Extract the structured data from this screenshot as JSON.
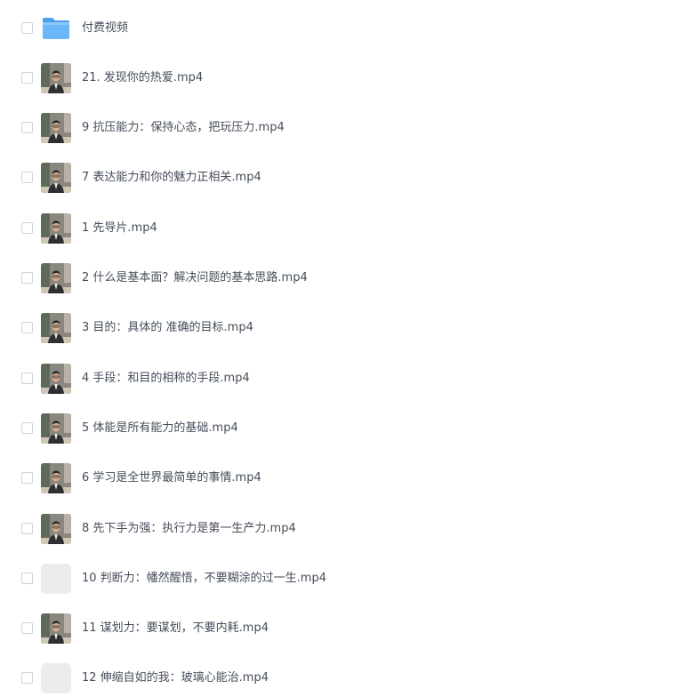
{
  "files": [
    {
      "name": "付费视频",
      "icon": "folder-icon"
    },
    {
      "name": "21. 发现你的热爱.mp4",
      "icon": "video-thumbnail"
    },
    {
      "name": "9 抗压能力：保持心态，把玩压力.mp4",
      "icon": "video-thumbnail"
    },
    {
      "name": "7 表达能力和你的魅力正相关.mp4",
      "icon": "video-thumbnail"
    },
    {
      "name": "1 先导片.mp4",
      "icon": "video-thumbnail"
    },
    {
      "name": "2 什么是基本面？解决问题的基本思路.mp4",
      "icon": "video-thumbnail"
    },
    {
      "name": "3 目的：具体的 准确的目标.mp4",
      "icon": "video-thumbnail"
    },
    {
      "name": "4 手段：和目的相称的手段.mp4",
      "icon": "video-thumbnail"
    },
    {
      "name": "5 体能是所有能力的基础.mp4",
      "icon": "video-thumbnail"
    },
    {
      "name": "6 学习是全世界最简单的事情.mp4",
      "icon": "video-thumbnail"
    },
    {
      "name": "8 先下手为强：执行力是第一生产力.mp4",
      "icon": "video-thumbnail"
    },
    {
      "name": "10 判断力：幡然醒悟，不要糊涂的过一生.mp4",
      "icon": "placeholder-thumbnail"
    },
    {
      "name": "11 谋划力：要谋划，不要内耗.mp4",
      "icon": "video-thumbnail"
    },
    {
      "name": "12 伸缩自如的我：玻璃心能治.mp4",
      "icon": "placeholder-thumbnail"
    }
  ],
  "colors": {
    "text": "#454d5a",
    "folder": "#5aaef5",
    "checkbox_border": "#cfd3da",
    "placeholder": "#ececee"
  }
}
